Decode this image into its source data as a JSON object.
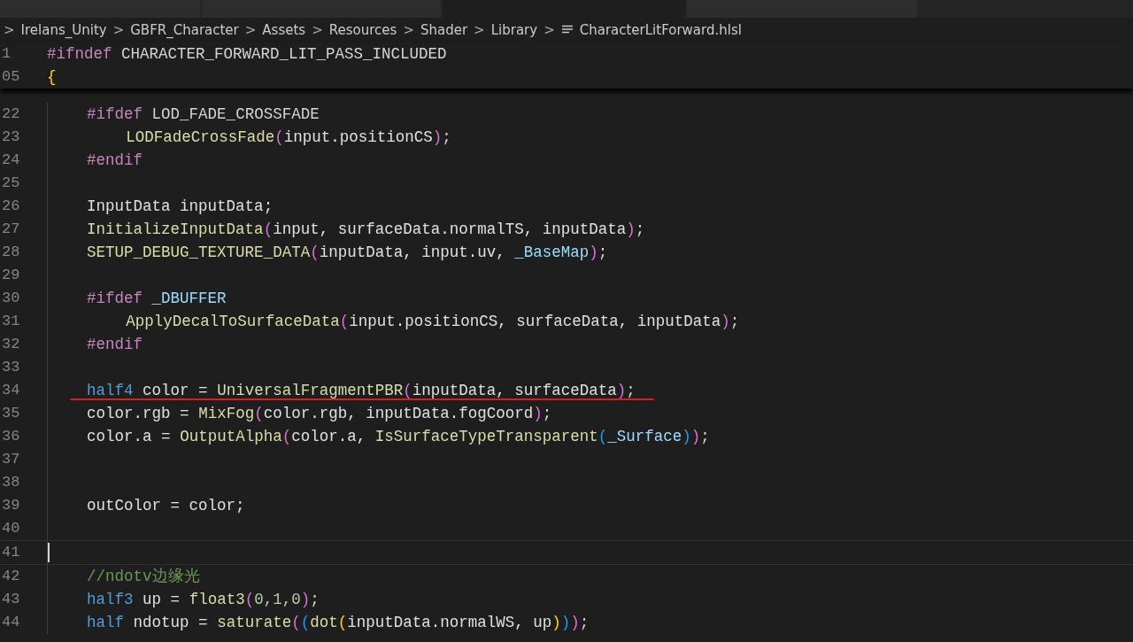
{
  "tabs": [
    {
      "selected": false
    },
    {
      "selected": false
    },
    {
      "selected": true
    },
    {
      "selected": false
    }
  ],
  "breadcrumb": [
    {
      "kind": "separator",
      "text": ">"
    },
    {
      "kind": "folder",
      "text": "Irelans_Unity"
    },
    {
      "kind": "separator",
      "text": ">"
    },
    {
      "kind": "folder",
      "text": "GBFR_Character"
    },
    {
      "kind": "separator",
      "text": ">"
    },
    {
      "kind": "folder",
      "text": "Assets"
    },
    {
      "kind": "separator",
      "text": ">"
    },
    {
      "kind": "folder",
      "text": "Resources"
    },
    {
      "kind": "separator",
      "text": ">"
    },
    {
      "kind": "folder",
      "text": "Shader"
    },
    {
      "kind": "separator",
      "text": ">"
    },
    {
      "kind": "folder",
      "text": "Library"
    },
    {
      "kind": "separator",
      "text": ">"
    },
    {
      "kind": "file",
      "text": "CharacterLitForward.hlsl"
    }
  ],
  "sticky_lines": [
    {
      "number": "1",
      "tokens": [
        {
          "kind": "kw",
          "text": "#ifndef"
        },
        {
          "kind": "plain",
          "text": " CHARACTER_FORWARD_LIT_PASS_INCLUDED"
        }
      ]
    },
    {
      "number": "05",
      "tokens": [
        {
          "kind": "p0",
          "text": "{"
        }
      ]
    }
  ],
  "lines": [
    {
      "number": "22",
      "current": false,
      "underlined": false,
      "nested": false,
      "tokens": [
        {
          "kind": "kw",
          "text": "#ifdef"
        },
        {
          "kind": "plain",
          "text": " LOD_FADE_CROSSFADE"
        }
      ]
    },
    {
      "number": "23",
      "current": false,
      "underlined": false,
      "nested": true,
      "tokens": [
        {
          "kind": "fn",
          "text": "LODFadeCrossFade"
        },
        {
          "kind": "p1",
          "text": "("
        },
        {
          "kind": "var",
          "text": "input.positionCS"
        },
        {
          "kind": "p1",
          "text": ")"
        },
        {
          "kind": "plain",
          "text": ";"
        }
      ]
    },
    {
      "number": "24",
      "current": false,
      "underlined": false,
      "nested": false,
      "tokens": [
        {
          "kind": "kw",
          "text": "#endif"
        }
      ]
    },
    {
      "number": "25",
      "current": false,
      "underlined": false
    },
    {
      "number": "26",
      "current": false,
      "underlined": false,
      "nested": false,
      "tokens": [
        {
          "kind": "var",
          "text": "InputData inputData;"
        }
      ]
    },
    {
      "number": "27",
      "current": false,
      "underlined": false,
      "nested": false,
      "tokens": [
        {
          "kind": "fn",
          "text": "InitializeInputData"
        },
        {
          "kind": "p1",
          "text": "("
        },
        {
          "kind": "var",
          "text": "input, surfaceData.normalTS, inputData"
        },
        {
          "kind": "p1",
          "text": ")"
        },
        {
          "kind": "plain",
          "text": ";"
        }
      ]
    },
    {
      "number": "28",
      "current": false,
      "underlined": false,
      "nested": false,
      "tokens": [
        {
          "kind": "fn",
          "text": "SETUP_DEBUG_TEXTURE_DATA"
        },
        {
          "kind": "p1",
          "text": "("
        },
        {
          "kind": "var",
          "text": "inputData, input.uv,"
        },
        {
          "kind": "const",
          "text": " _BaseMap"
        },
        {
          "kind": "p1",
          "text": ")"
        },
        {
          "kind": "plain",
          "text": ";"
        }
      ]
    },
    {
      "number": "29",
      "current": false,
      "underlined": false
    },
    {
      "number": "30",
      "current": false,
      "underlined": false,
      "nested": false,
      "tokens": [
        {
          "kind": "kw",
          "text": "#ifdef"
        },
        {
          "kind": "const",
          "text": " _DBUFFER"
        }
      ]
    },
    {
      "number": "31",
      "current": false,
      "underlined": false,
      "nested": true,
      "tokens": [
        {
          "kind": "fn",
          "text": "ApplyDecalToSurfaceData"
        },
        {
          "kind": "p1",
          "text": "("
        },
        {
          "kind": "var",
          "text": "input.positionCS, surfaceData, inputData"
        },
        {
          "kind": "p1",
          "text": ")"
        },
        {
          "kind": "plain",
          "text": ";"
        }
      ]
    },
    {
      "number": "32",
      "current": false,
      "underlined": false,
      "nested": false,
      "tokens": [
        {
          "kind": "kw",
          "text": "#endif"
        }
      ]
    },
    {
      "number": "33",
      "current": false,
      "underlined": false
    },
    {
      "number": "34",
      "current": false,
      "underlined": true,
      "nested": false,
      "tokens": [
        {
          "kind": "type",
          "text": "half4"
        },
        {
          "kind": "var",
          "text": " color = "
        },
        {
          "kind": "fn",
          "text": "UniversalFragmentPBR"
        },
        {
          "kind": "p1",
          "text": "("
        },
        {
          "kind": "var",
          "text": "inputData, surfaceData"
        },
        {
          "kind": "p1",
          "text": ")"
        },
        {
          "kind": "plain",
          "text": ";"
        }
      ]
    },
    {
      "number": "35",
      "current": false,
      "underlined": false,
      "nested": false,
      "tokens": [
        {
          "kind": "var",
          "text": "color.rgb = "
        },
        {
          "kind": "fn",
          "text": "MixFog"
        },
        {
          "kind": "p1",
          "text": "("
        },
        {
          "kind": "var",
          "text": "color.rgb, inputData.fogCoord"
        },
        {
          "kind": "p1",
          "text": ")"
        },
        {
          "kind": "plain",
          "text": ";"
        }
      ]
    },
    {
      "number": "36",
      "current": false,
      "underlined": false,
      "nested": false,
      "tokens": [
        {
          "kind": "var",
          "text": "color.a = "
        },
        {
          "kind": "fn",
          "text": "OutputAlpha"
        },
        {
          "kind": "p1",
          "text": "("
        },
        {
          "kind": "var",
          "text": "color.a, "
        },
        {
          "kind": "fn",
          "text": "IsSurfaceTypeTransparent"
        },
        {
          "kind": "p2",
          "text": "("
        },
        {
          "kind": "const",
          "text": "_Surface"
        },
        {
          "kind": "p2",
          "text": ")"
        },
        {
          "kind": "p1",
          "text": ")"
        },
        {
          "kind": "plain",
          "text": ";"
        }
      ]
    },
    {
      "number": "37",
      "current": false,
      "underlined": false
    },
    {
      "number": "38",
      "current": false,
      "underlined": false
    },
    {
      "number": "39",
      "current": false,
      "underlined": false,
      "nested": false,
      "tokens": [
        {
          "kind": "var",
          "text": "outColor = color;"
        }
      ]
    },
    {
      "number": "40",
      "current": false,
      "underlined": false
    },
    {
      "number": "41",
      "current": true,
      "underlined": false
    },
    {
      "number": "42",
      "current": false,
      "underlined": false,
      "nested": false,
      "tokens": [
        {
          "kind": "comment",
          "text": "//ndotv边缘光"
        }
      ]
    },
    {
      "number": "43",
      "current": false,
      "underlined": false,
      "nested": false,
      "tokens": [
        {
          "kind": "type",
          "text": "half3"
        },
        {
          "kind": "var",
          "text": " up = "
        },
        {
          "kind": "fn",
          "text": "float3"
        },
        {
          "kind": "p1",
          "text": "("
        },
        {
          "kind": "num",
          "text": "0,1,0"
        },
        {
          "kind": "p1",
          "text": ")"
        },
        {
          "kind": "plain",
          "text": ";"
        }
      ]
    },
    {
      "number": "44",
      "current": false,
      "underlined": false,
      "nested": false,
      "tokens": [
        {
          "kind": "type",
          "text": "half"
        },
        {
          "kind": "var",
          "text": " ndotup = "
        },
        {
          "kind": "fn",
          "text": "saturate"
        },
        {
          "kind": "p1",
          "text": "("
        },
        {
          "kind": "p2",
          "text": "("
        },
        {
          "kind": "fn",
          "text": "dot"
        },
        {
          "kind": "p3",
          "text": "("
        },
        {
          "kind": "var",
          "text": "inputData.normalWS, up"
        },
        {
          "kind": "p3",
          "text": ")"
        },
        {
          "kind": "p2",
          "text": ")"
        },
        {
          "kind": "p1",
          "text": ")"
        },
        {
          "kind": "plain",
          "text": ";"
        }
      ]
    }
  ]
}
